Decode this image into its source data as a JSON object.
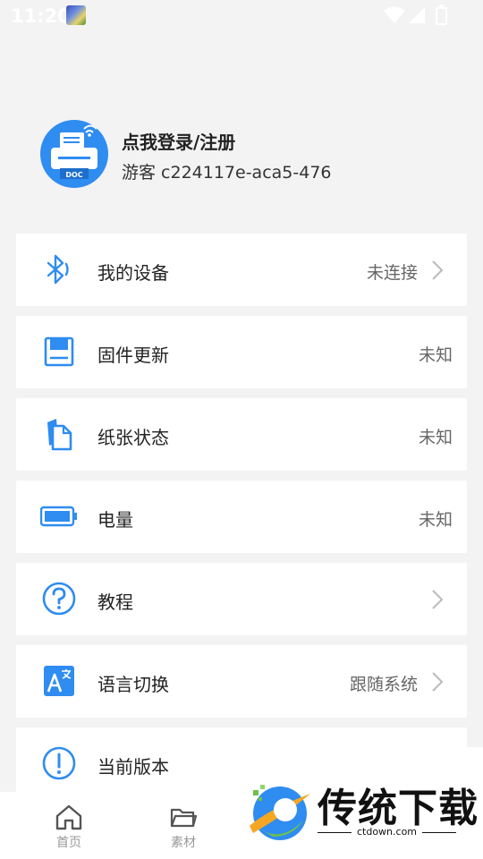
{
  "status_bar": {
    "time": "11:20"
  },
  "profile": {
    "title": "点我登录/注册",
    "guest_id": "游客 c224117e-aca5-476",
    "avatar_label": "DOC"
  },
  "menu": {
    "items": [
      {
        "label": "我的设备",
        "value": "未连接",
        "icon": "bluetooth-icon",
        "chevron": true
      },
      {
        "label": "固件更新",
        "value": "未知",
        "icon": "firmware-save-icon",
        "chevron": false
      },
      {
        "label": "纸张状态",
        "value": "未知",
        "icon": "paper-icon",
        "chevron": false
      },
      {
        "label": "电量",
        "value": "未知",
        "icon": "battery-icon",
        "chevron": false
      },
      {
        "label": "教程",
        "value": "",
        "icon": "help-icon",
        "chevron": true
      },
      {
        "label": "语言切换",
        "value": "跟随系统",
        "icon": "language-icon",
        "chevron": true
      },
      {
        "label": "当前版本",
        "value": "",
        "icon": "info-icon",
        "chevron": false
      }
    ]
  },
  "bottom_nav": {
    "items": [
      {
        "label": "首页",
        "icon": "home-icon"
      },
      {
        "label": "素材",
        "icon": "folder-icon"
      }
    ]
  },
  "watermark": {
    "title": "传统下载",
    "url": "ctdown.com"
  },
  "colors": {
    "accent": "#2f8cf0",
    "background": "#f3f3f3"
  }
}
